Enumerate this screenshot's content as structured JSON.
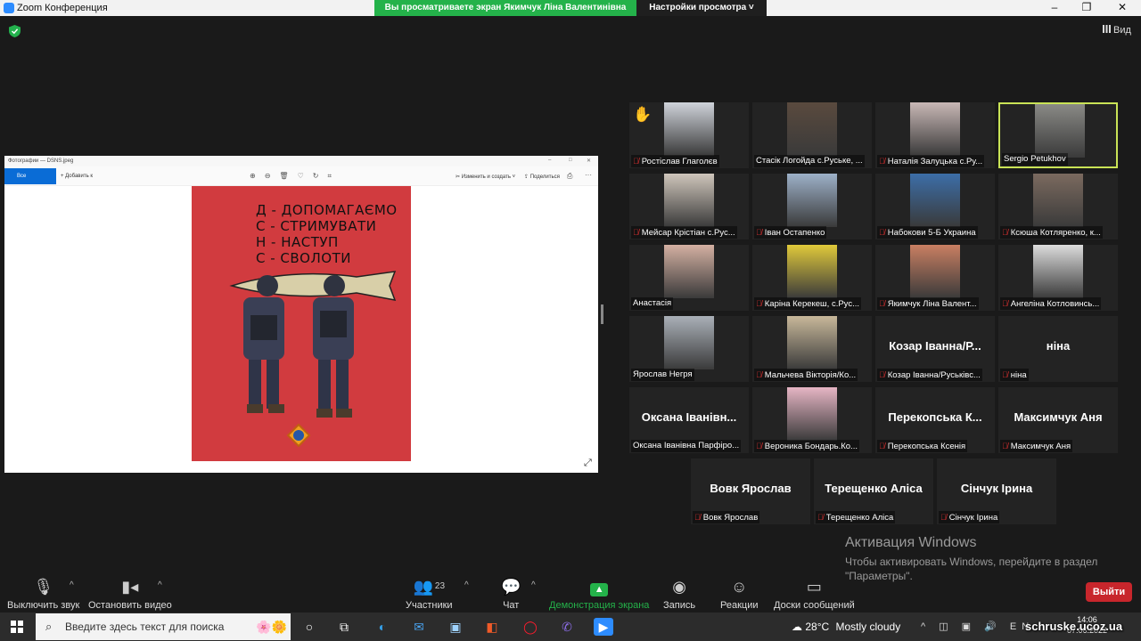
{
  "window": {
    "title": "Zoom Конференция",
    "share_banner": "Вы просматриваете экран Якимчук Ліна Валентинівна",
    "view_options": "Настройки просмотра",
    "view_button": "Вид",
    "minimize": "–",
    "maximize": "❐",
    "close": "✕"
  },
  "shared_screen": {
    "app_title": "Фотографии — DSNS.jpeg",
    "all_photos": "Все фотографии",
    "add_to": "Добавить к",
    "edit_create": "Изменить и создать",
    "share": "Поделиться",
    "poster_lines": [
      "Д - ДОПОМАГАЄМО",
      "С - СТРИМУВАТИ",
      "Н - НАСТУП",
      "С - СВОЛОТИ"
    ]
  },
  "participants": [
    {
      "name": "Ростіслав Глаголєв",
      "video": true,
      "muted": true,
      "raised_hand": true,
      "color": "#cfd3da"
    },
    {
      "name": "Стасік Логойда с.Руське, ...",
      "video": true,
      "muted": false,
      "color": "#5a4a3e"
    },
    {
      "name": "Наталія Залуцька с.Ру...",
      "video": true,
      "muted": true,
      "color": "#c9b8b6"
    },
    {
      "name": "Sergio Petukhov",
      "video": true,
      "muted": false,
      "active": true,
      "color": "#8a8a86"
    },
    {
      "name": "Мейсар Крістіан с.Рус...",
      "video": true,
      "muted": true,
      "color": "#cfc6bb"
    },
    {
      "name": "Іван Остапенко",
      "video": true,
      "muted": true,
      "color": "#9db1c8"
    },
    {
      "name": "Набокови 5-Б Украина",
      "video": true,
      "muted": true,
      "color": "#3c6ea8"
    },
    {
      "name": "Ксюша Котляренко, к...",
      "video": true,
      "muted": true,
      "color": "#7b6a5f"
    },
    {
      "name": "Анастасія",
      "video": true,
      "muted": false,
      "color": "#d4b0a2"
    },
    {
      "name": "Каріна Керекеш, с.Рус...",
      "video": true,
      "muted": true,
      "color": "#e0c93a"
    },
    {
      "name": "Якимчук Ліна Валент...",
      "video": true,
      "muted": true,
      "color": "#c97f62"
    },
    {
      "name": "Ангеліна Котловинсь...",
      "video": true,
      "muted": true,
      "color": "#dcdcdc"
    },
    {
      "name": "Ярослав Негря",
      "video": true,
      "muted": false,
      "color": "#aab0b8"
    },
    {
      "name": "Мальчева Вікторія/Ко...",
      "video": true,
      "muted": true,
      "color": "#c8b89a"
    },
    {
      "name": "Козар Іванна/Руськівс...",
      "big": "Козар Іванна/Р...",
      "video": false,
      "muted": true
    },
    {
      "name": "ніна",
      "big": "ніна",
      "video": false,
      "muted": true
    },
    {
      "name": "Оксана Іванівна Парфіро...",
      "big": "Оксана Іванівн...",
      "video": false,
      "muted": false
    },
    {
      "name": "Вероника Бондарь.Ко...",
      "video": true,
      "muted": true,
      "color": "#e6b5c4"
    },
    {
      "name": "Перекопська Ксенія",
      "big": "Перекопська К...",
      "video": false,
      "muted": true
    },
    {
      "name": "Максимчук Аня",
      "big": "Максимчук Аня",
      "video": false,
      "muted": true
    },
    {
      "name": "Вовк Ярослав",
      "big": "Вовк Ярослав",
      "video": false,
      "muted": true
    },
    {
      "name": "Терещенко Аліса",
      "big": "Терещенко Аліса",
      "video": false,
      "muted": true
    },
    {
      "name": "Сінчук Ірина",
      "big": "Сінчук Ірина",
      "video": false,
      "muted": true
    }
  ],
  "activation": {
    "title": "Активация Windows",
    "subtitle_line1": "Чтобы активировать Windows, перейдите в раздел",
    "subtitle_line2": "\"Параметры\"."
  },
  "controls": {
    "mute": "Выключить звук",
    "stop_video": "Остановить видео",
    "participants": "Участники",
    "participants_count": "23",
    "chat": "Чат",
    "share_screen": "Демонстрация экрана",
    "record": "Запись",
    "reactions": "Реакции",
    "whiteboards": "Доски сообщений",
    "leave": "Выйти"
  },
  "taskbar": {
    "search_placeholder": "Введите здесь текст для поиска",
    "temperature": "28°C",
    "weather": "Mostly cloudy",
    "time": "14:06",
    "date": "07.06.2022"
  },
  "watermark": "schruske.ucoz.ua",
  "colors": {
    "share_green": "#24b24a",
    "leave_red": "#c8262c",
    "active_border": "#c9e356",
    "poster_red": "#d13b3f"
  }
}
